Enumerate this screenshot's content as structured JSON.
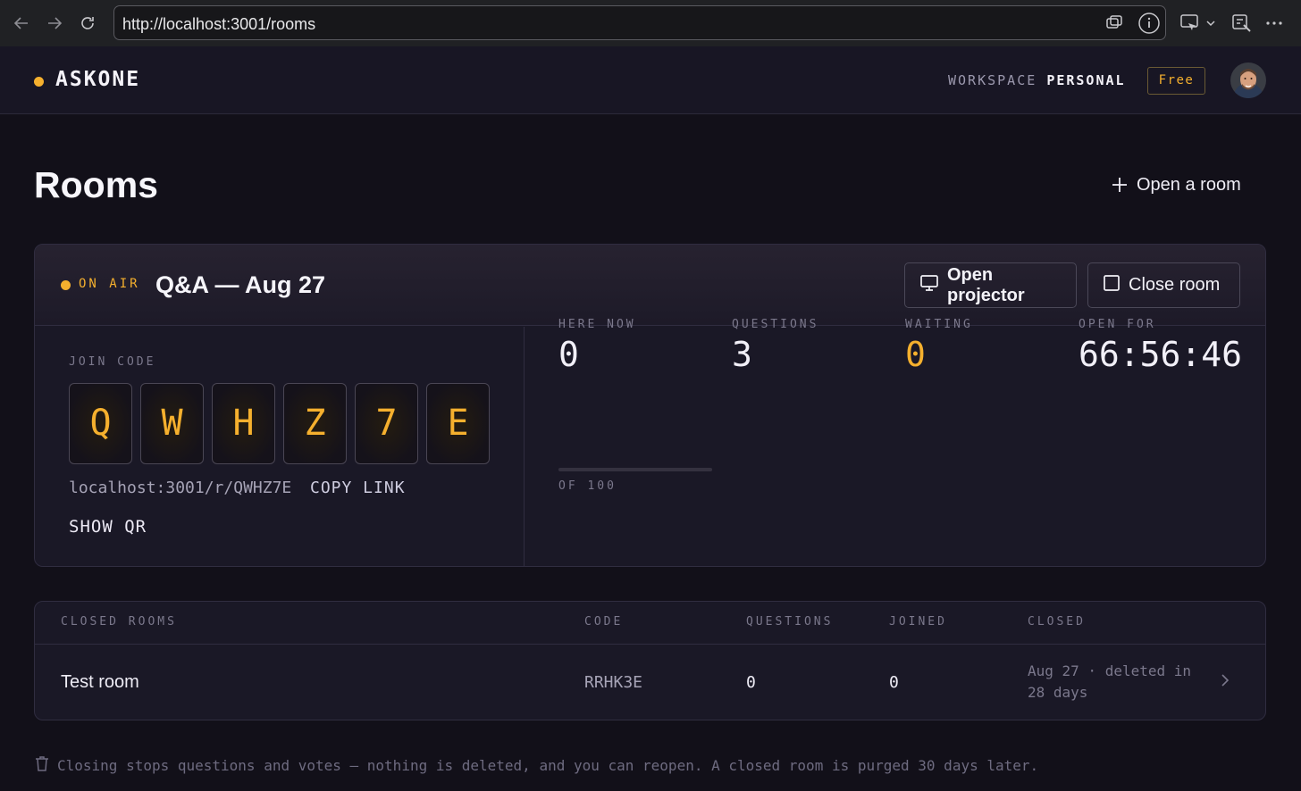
{
  "browser": {
    "url": "http://localhost:3001/rooms"
  },
  "header": {
    "brand": "ASKONE",
    "workspace_key": "WORKSPACE",
    "workspace_value": "PERSONAL",
    "plan_badge": "Free"
  },
  "page": {
    "title": "Rooms",
    "open_room_label": "Open a room"
  },
  "active_room": {
    "status": "ON AIR",
    "name": "Q&A — Aug 27",
    "open_projector_label": "Open projector",
    "close_room_label": "Close room",
    "join_code_label": "JOIN CODE",
    "join_code_chars": [
      "Q",
      "W",
      "H",
      "Z",
      "7",
      "E"
    ],
    "join_url": "localhost:3001/r/QWHZ7E",
    "copy_link_label": "COPY LINK",
    "show_qr_label": "SHOW QR",
    "stats": {
      "here_now_label": "HERE NOW",
      "here_now_value": "0",
      "here_now_capacity_label": "OF 100",
      "here_now_fraction": 0,
      "questions_label": "QUESTIONS",
      "questions_value": "3",
      "waiting_label": "WAITING",
      "waiting_value": "0",
      "open_for_label": "OPEN FOR",
      "open_for_value": "66:56:46"
    }
  },
  "closed_rooms": {
    "columns": [
      "CLOSED ROOMS",
      "CODE",
      "QUESTIONS",
      "JOINED",
      "CLOSED"
    ],
    "rows": [
      {
        "name": "Test room",
        "code": "RRHK3E",
        "questions": "0",
        "joined": "0",
        "closed_line1": "Aug 27 · deleted in",
        "closed_line2": "28 days"
      }
    ]
  },
  "footer_note": "Closing stops questions and votes — nothing is deleted, and you can reopen. A closed room is purged 30 days later.",
  "colors": {
    "accent": "#f5b02e",
    "background": "#121019",
    "card": "#1a1826"
  }
}
